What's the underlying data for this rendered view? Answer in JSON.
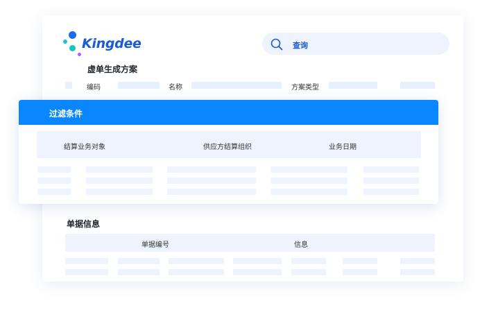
{
  "logo": {
    "text": "Kingdee"
  },
  "search": {
    "label": "查询",
    "icon": "search-icon"
  },
  "scheme": {
    "title": "虚单生成方案",
    "columns": [
      "编码",
      "名称",
      "方案类型"
    ]
  },
  "filter": {
    "title": "过滤条件",
    "columns": [
      "结算业务对象",
      "供应方结算组织",
      "业务日期"
    ]
  },
  "doc_info": {
    "title": "单据信息",
    "columns": [
      "单据编号",
      "信息"
    ]
  },
  "colors": {
    "brand_blue": "#1a5bd6",
    "header_blue": "#0a86ff",
    "placeholder": "#e9f0fd"
  }
}
